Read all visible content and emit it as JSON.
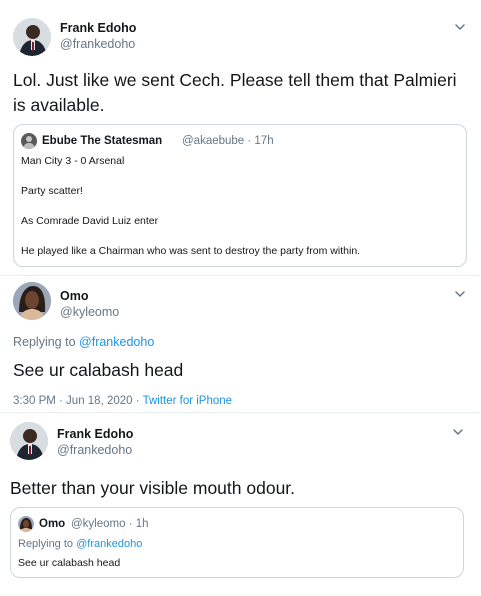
{
  "tweet1": {
    "name": "Frank Edoho",
    "handle": "@frankedoho",
    "text": "Lol. Just like we sent Cech. Please tell them that Palmieri is available.",
    "quote": {
      "name": "Ebube The Statesman",
      "meta": "@akaebube · 17h",
      "lines": [
        "Man City 3 - 0 Arsenal",
        "Party scatter!",
        "As Comrade David Luiz enter",
        "He played like a Chairman who was sent to destroy the party from within."
      ]
    }
  },
  "tweet2": {
    "name": "Omo",
    "handle": "@kyleomo",
    "replying_prefix": "Replying to",
    "replying_handle": "@frankedoho",
    "text": "See ur calabash head",
    "timestamp": "3:30 PM · Jun 18, 2020 ·",
    "source": "Twitter for iPhone"
  },
  "tweet3": {
    "name": "Frank Edoho",
    "handle": "@frankedoho",
    "text": "Better than your visible mouth odour.",
    "quote": {
      "name": "Omo",
      "meta": "@kyleomo · 1h",
      "replying_prefix": "Replying to",
      "replying_handle": "@frankedoho",
      "text": "See ur calabash head"
    }
  },
  "icons": {
    "more": "chevron-down-icon",
    "avatar": "user-avatar"
  },
  "colors": {
    "link": "#1b95e0",
    "secondary_text": "#657786",
    "border": "#ccd6dd"
  }
}
